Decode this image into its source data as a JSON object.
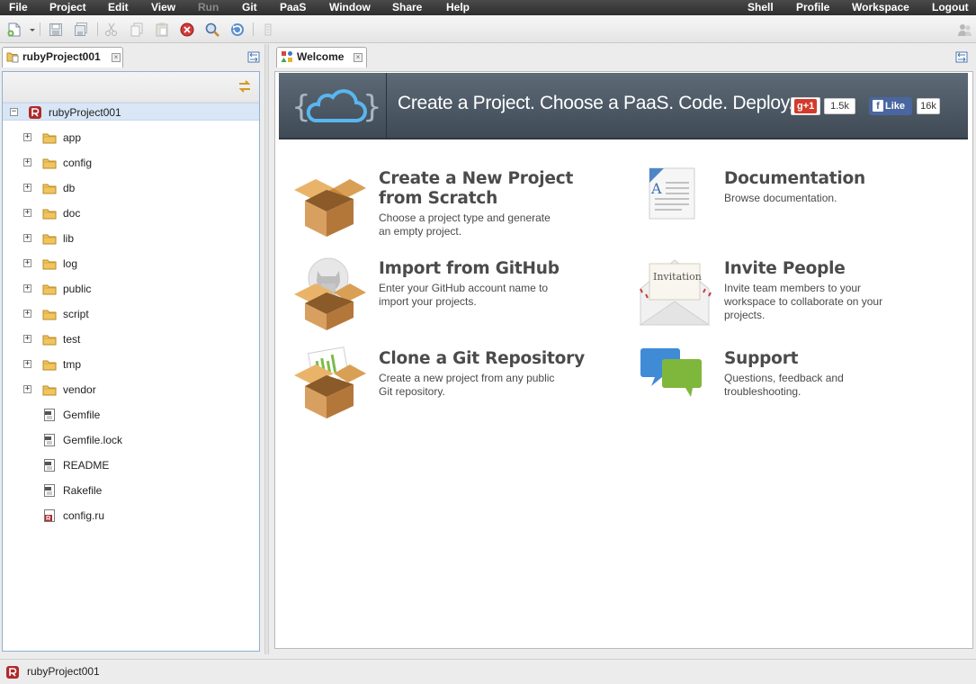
{
  "menubar": {
    "left_items": [
      {
        "label": "File",
        "enabled": true
      },
      {
        "label": "Project",
        "enabled": true
      },
      {
        "label": "Edit",
        "enabled": true
      },
      {
        "label": "View",
        "enabled": true
      },
      {
        "label": "Run",
        "enabled": false
      },
      {
        "label": "Git",
        "enabled": true
      },
      {
        "label": "PaaS",
        "enabled": true
      },
      {
        "label": "Window",
        "enabled": true
      },
      {
        "label": "Share",
        "enabled": true
      },
      {
        "label": "Help",
        "enabled": true
      }
    ],
    "right_items": [
      {
        "label": "Shell"
      },
      {
        "label": "Profile"
      },
      {
        "label": "Workspace"
      },
      {
        "label": "Logout"
      }
    ]
  },
  "project_explorer": {
    "tab_label": "rubyProject001",
    "root": {
      "label": "rubyProject001",
      "expanded": true
    },
    "folders": [
      "app",
      "config",
      "db",
      "doc",
      "lib",
      "log",
      "public",
      "script",
      "test",
      "tmp",
      "vendor"
    ],
    "files": [
      {
        "label": "Gemfile",
        "icon": "text-file-icon"
      },
      {
        "label": "Gemfile.lock",
        "icon": "text-file-icon"
      },
      {
        "label": "README",
        "icon": "text-file-icon"
      },
      {
        "label": "Rakefile",
        "icon": "text-file-icon"
      },
      {
        "label": "config.ru",
        "icon": "ruby-file-icon"
      }
    ]
  },
  "welcome": {
    "tab_label": "Welcome",
    "banner": {
      "title": "Create a Project. Choose a PaaS. Code. Deploy.",
      "gplus_label": "+1",
      "gplus_count": "1.5k",
      "fb_label": "Like",
      "fb_count": "16k"
    },
    "cards": [
      {
        "title_line1": "Create a New Project",
        "title_line2": "from Scratch",
        "desc_line1": "Choose a project type and generate",
        "desc_line2": "an empty project.",
        "desc_line3": ""
      },
      {
        "title_line1": "Documentation",
        "title_line2": "",
        "desc_line1": "Browse documentation.",
        "desc_line2": "",
        "desc_line3": ""
      },
      {
        "title_line1": "Import from GitHub",
        "title_line2": "",
        "desc_line1": "Enter your GitHub account name to",
        "desc_line2": "import your projects.",
        "desc_line3": ""
      },
      {
        "title_line1": "Invite People",
        "title_line2": "",
        "desc_line1": "Invite team members to your",
        "desc_line2": "workspace to collaborate on your",
        "desc_line3": "projects."
      },
      {
        "title_line1": "Clone a Git Repository",
        "title_line2": "",
        "desc_line1": "Create a new project from any public",
        "desc_line2": "Git repository.",
        "desc_line3": ""
      },
      {
        "title_line1": "Support",
        "title_line2": "",
        "desc_line1": "Questions, feedback and",
        "desc_line2": "troubleshooting.",
        "desc_line3": ""
      }
    ],
    "invitation_label": "Invitation"
  },
  "statusbar": {
    "project_label": "rubyProject001"
  },
  "colors": {
    "menubar": "#333333",
    "banner": "#4d5965",
    "selection": "#d8e6f6",
    "folder": "#e8b64a"
  }
}
